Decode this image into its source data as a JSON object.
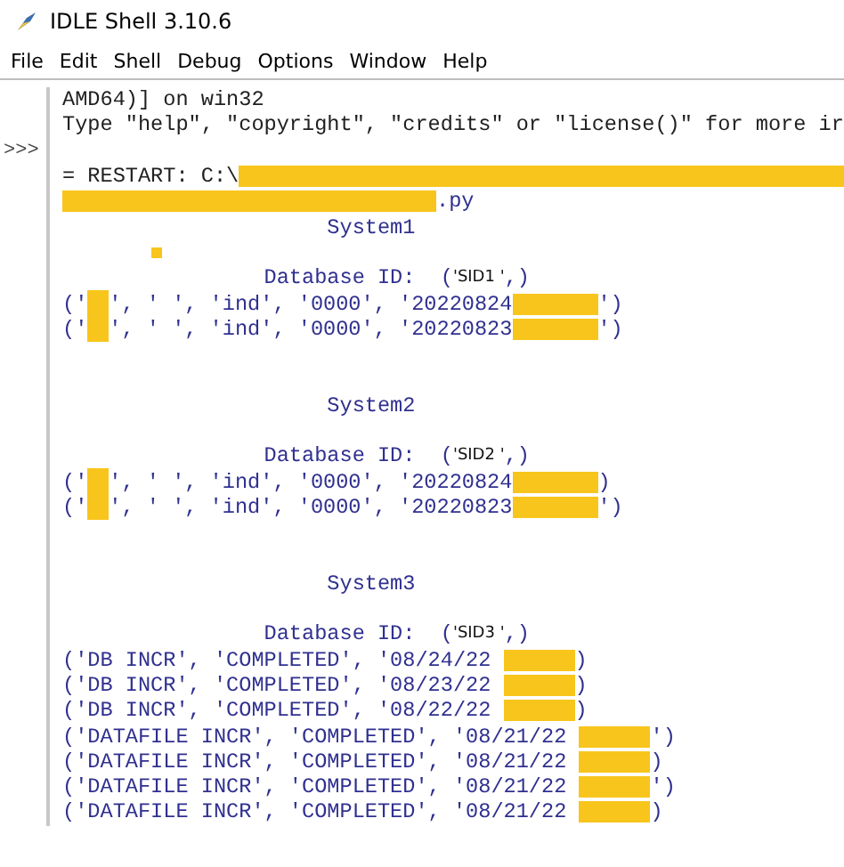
{
  "window": {
    "title": "IDLE Shell 3.10.6"
  },
  "menu": [
    "File",
    "Edit",
    "Shell",
    "Debug",
    "Options",
    "Window",
    "Help"
  ],
  "shell": {
    "lines": [
      {
        "kind": "console",
        "segments": [
          {
            "kind": "text",
            "text": "AMD64)] on win32"
          }
        ]
      },
      {
        "kind": "console",
        "segments": [
          {
            "kind": "text",
            "text": "Type \"help\", \"copyright\", \"credits\" or \"license()\" for more ir"
          }
        ]
      },
      {
        "kind": "console",
        "prompt": ">>>"
      },
      {
        "kind": "console",
        "segments": [
          {
            "kind": "text",
            "text": "= RESTART: C:\\"
          },
          {
            "kind": "redaction_rest"
          }
        ]
      },
      {
        "kind": "stdout",
        "segments": [
          {
            "kind": "redaction_long"
          },
          {
            "kind": "text",
            "text": ".py"
          }
        ]
      },
      {
        "kind": "stdout",
        "segments": [
          {
            "kind": "text",
            "text": "                     System1"
          }
        ]
      },
      {
        "kind": "stdout",
        "segments": [
          {
            "kind": "redaction_dot"
          }
        ]
      },
      {
        "kind": "stdout",
        "segments": [
          {
            "kind": "text",
            "text": "                Database ID:  ("
          },
          {
            "kind": "sans",
            "text": "'SID1 '"
          },
          {
            "kind": "text",
            "text": ",)"
          }
        ]
      },
      {
        "kind": "stdout",
        "segments": [
          {
            "kind": "text",
            "text": "('"
          },
          {
            "kind": "redaction_block"
          },
          {
            "kind": "text",
            "text": "', ' ', 'ind', '0000', '20220824"
          },
          {
            "kind": "redaction_medium"
          },
          {
            "kind": "text",
            "text": "')"
          }
        ]
      },
      {
        "kind": "stdout",
        "segments": [
          {
            "kind": "text",
            "text": "('"
          },
          {
            "kind": "redaction_block"
          },
          {
            "kind": "text",
            "text": "', ' ', 'ind', '0000', '20220823"
          },
          {
            "kind": "redaction_medium"
          },
          {
            "kind": "text",
            "text": "')"
          }
        ]
      },
      {
        "kind": "stdout"
      },
      {
        "kind": "stdout"
      },
      {
        "kind": "stdout",
        "segments": [
          {
            "kind": "text",
            "text": "                     System2"
          }
        ]
      },
      {
        "kind": "stdout"
      },
      {
        "kind": "stdout",
        "segments": [
          {
            "kind": "text",
            "text": "                Database ID:  ("
          },
          {
            "kind": "sans",
            "text": "'SID2 '"
          },
          {
            "kind": "text",
            "text": ",)"
          }
        ]
      },
      {
        "kind": "stdout",
        "segments": [
          {
            "kind": "text",
            "text": "('"
          },
          {
            "kind": "redaction_block"
          },
          {
            "kind": "text",
            "text": "', ' ', 'ind', '0000', '20220824"
          },
          {
            "kind": "redaction_medium"
          },
          {
            "kind": "text",
            "text": ")"
          }
        ]
      },
      {
        "kind": "stdout",
        "segments": [
          {
            "kind": "text",
            "text": "('"
          },
          {
            "kind": "redaction_block"
          },
          {
            "kind": "text",
            "text": "', ' ', 'ind', '0000', '20220823"
          },
          {
            "kind": "redaction_medium"
          },
          {
            "kind": "text",
            "text": "')"
          }
        ]
      },
      {
        "kind": "stdout"
      },
      {
        "kind": "stdout"
      },
      {
        "kind": "stdout",
        "segments": [
          {
            "kind": "text",
            "text": "                     System3"
          }
        ]
      },
      {
        "kind": "stdout"
      },
      {
        "kind": "stdout",
        "segments": [
          {
            "kind": "text",
            "text": "                Database ID:  ("
          },
          {
            "kind": "sans",
            "text": "'SID3 '"
          },
          {
            "kind": "text",
            "text": ",)"
          }
        ]
      },
      {
        "kind": "stdout",
        "segments": [
          {
            "kind": "text",
            "text": "('DB INCR', 'COMPLETED', '08/24/22 "
          },
          {
            "kind": "redaction_short"
          },
          {
            "kind": "text",
            "text": ")"
          }
        ]
      },
      {
        "kind": "stdout",
        "segments": [
          {
            "kind": "text",
            "text": "('DB INCR', 'COMPLETED', '08/23/22 "
          },
          {
            "kind": "redaction_short"
          },
          {
            "kind": "text",
            "text": ")"
          }
        ]
      },
      {
        "kind": "stdout",
        "segments": [
          {
            "kind": "text",
            "text": "('DB INCR', 'COMPLETED', '08/22/22 "
          },
          {
            "kind": "redaction_short"
          },
          {
            "kind": "text",
            "text": ")"
          }
        ]
      },
      {
        "kind": "stdout",
        "segments": [
          {
            "kind": "text",
            "text": "('DATAFILE INCR', 'COMPLETED', '08/21/22 "
          },
          {
            "kind": "redaction_short"
          },
          {
            "kind": "text",
            "text": "')"
          }
        ]
      },
      {
        "kind": "stdout",
        "segments": [
          {
            "kind": "text",
            "text": "('DATAFILE INCR', 'COMPLETED', '08/21/22 "
          },
          {
            "kind": "redaction_short"
          },
          {
            "kind": "text",
            "text": ")"
          }
        ]
      },
      {
        "kind": "stdout",
        "segments": [
          {
            "kind": "text",
            "text": "('DATAFILE INCR', 'COMPLETED', '08/21/22 "
          },
          {
            "kind": "redaction_short"
          },
          {
            "kind": "text",
            "text": "')"
          }
        ]
      },
      {
        "kind": "stdout",
        "segments": [
          {
            "kind": "text",
            "text": "('DATAFILE INCR', 'COMPLETED', '08/21/22 "
          },
          {
            "kind": "redaction_short"
          },
          {
            "kind": "text",
            "text": ")"
          }
        ]
      }
    ]
  }
}
